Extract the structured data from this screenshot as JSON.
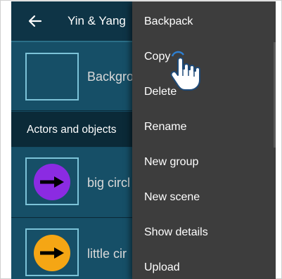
{
  "appbar": {
    "title": "Yin & Yang",
    "back_icon": "arrow-left-icon"
  },
  "background_row": {
    "label": "Backgro"
  },
  "section": {
    "label": "Actors and objects"
  },
  "actors": [
    {
      "label": "big circl",
      "circle_color": "#8b2be2"
    },
    {
      "label": "little cir",
      "circle_color": "#f5a614"
    }
  ],
  "menu": {
    "items": [
      {
        "label": "Backpack"
      },
      {
        "label": "Copy"
      },
      {
        "label": "Delete"
      },
      {
        "label": "Rename"
      },
      {
        "label": "New group"
      },
      {
        "label": "New scene"
      },
      {
        "label": "Show details"
      },
      {
        "label": "Upload"
      }
    ]
  },
  "colors": {
    "appbar": "#0e3446",
    "row_background": "#164f67",
    "menu_background": "#3d3d3d",
    "accent": "#7cc3d8"
  },
  "pointer": {
    "icon": "hand-pointer-icon"
  }
}
